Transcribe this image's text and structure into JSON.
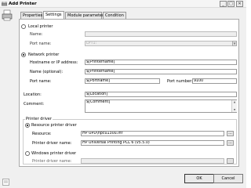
{
  "window": {
    "title": "Add Printer",
    "min": "_",
    "max": "□",
    "close": "✕"
  },
  "tabs": [
    "Properties",
    "Settings",
    "Module parameters",
    "Condition"
  ],
  "local": {
    "radio_label": "Local printer",
    "name_label": "Name:",
    "port_label": "Port name:",
    "port_value": "LPT1:"
  },
  "network": {
    "radio_label": "Network printer",
    "host_label": "Hostname or IP address:",
    "host_value": "$[Printername]",
    "name_label": "Name (optional):",
    "name_value": "$[Printername]",
    "port_label": "Port name:",
    "port_value": "$[Portname]",
    "portnum_label": "Port number:",
    "portnum_value": "9100"
  },
  "location": {
    "label": "Location:",
    "value": "$[Location]"
  },
  "comment": {
    "label": "Comment:",
    "value": "$[Comment]"
  },
  "driver": {
    "group_label": "Printer driver",
    "resource_radio": "Resource printer driver",
    "resource_label": "Resource:",
    "resource_value": "HP UPD\\hpcu130u.inf",
    "driver_name_label": "Printer driver name:",
    "driver_name_value": "HP Universal Printing PCL 6 (v5.5.0)",
    "windows_radio": "Windows printer driver",
    "win_driver_label": "Printer driver name:",
    "browse": "..."
  },
  "buttons": {
    "ok": "OK",
    "cancel": "Cancel"
  }
}
